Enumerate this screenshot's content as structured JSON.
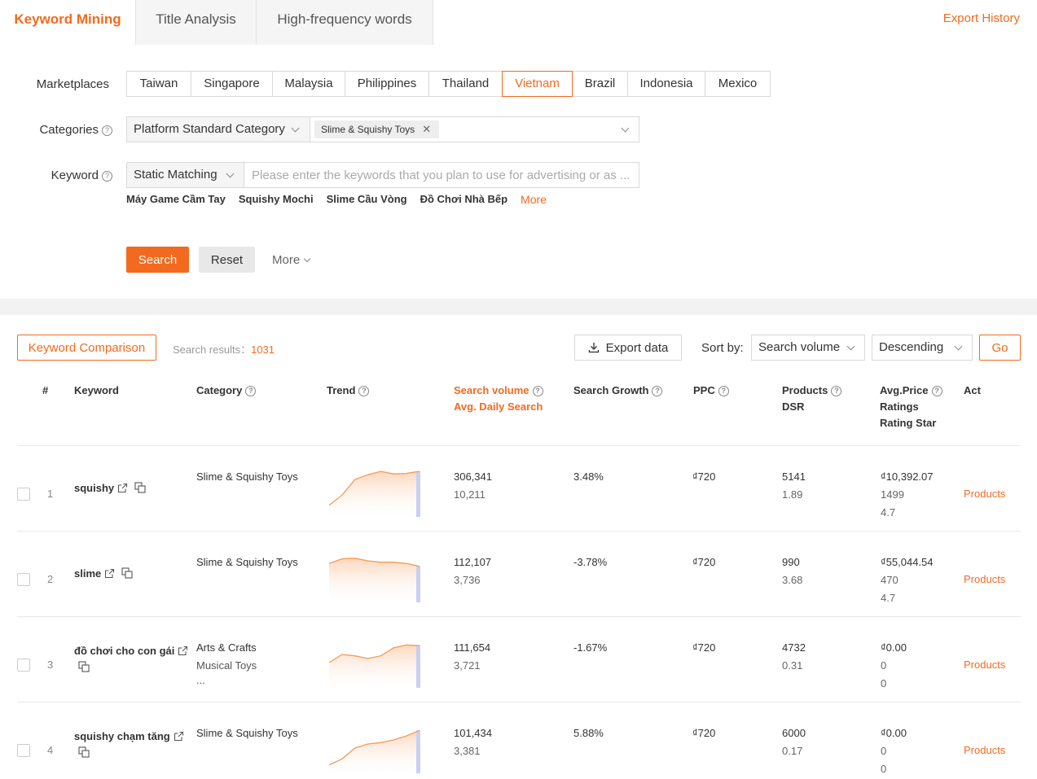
{
  "tabs": [
    "Keyword Mining",
    "Title Analysis",
    "High-frequency words"
  ],
  "export_history": "Export History",
  "filters": {
    "marketplaces_label": "Marketplaces",
    "marketplaces": [
      "Taiwan",
      "Singapore",
      "Malaysia",
      "Philippines",
      "Thailand",
      "Vietnam",
      "Brazil",
      "Indonesia",
      "Mexico"
    ],
    "selected_marketplace": "Vietnam",
    "categories_label": "Categories",
    "category_type": "Platform Standard Category",
    "category_tag": "Slime & Squishy Toys",
    "keyword_label": "Keyword",
    "match_type": "Static Matching",
    "keyword_placeholder": "Please enter the keywords that you plan to use for advertising or as ...",
    "suggestions": [
      "Máy Game Cầm Tay",
      "Squishy Mochi",
      "Slime Cầu Vòng",
      "Đồ Chơi Nhà Bếp"
    ],
    "suggest_more": "More",
    "search_btn": "Search",
    "reset_btn": "Reset",
    "more_toggle": "More"
  },
  "toolbar": {
    "compare_btn": "Keyword Comparison",
    "results_label": "Search results：",
    "results_count": "1031",
    "export_btn": "Export data",
    "sort_label": "Sort by:",
    "sort_field": "Search volume",
    "sort_order": "Descending",
    "go_btn": "Go"
  },
  "columns": {
    "index": "#",
    "keyword": "Keyword",
    "category": "Category",
    "trend": "Trend",
    "search_volume": "Search volume",
    "avg_daily": "Avg. Daily Search",
    "growth": "Search Growth",
    "ppc": "PPC",
    "products": "Products",
    "dsr": "DSR",
    "avg_price": "Avg.Price",
    "ratings": "Ratings",
    "rating_star": "Rating Star",
    "act": "Act"
  },
  "rows": [
    {
      "index": "1",
      "keyword": "squishy",
      "cat1": "Slime & Squishy Toys",
      "cat2": "",
      "cat3": "",
      "volume": "306,341",
      "daily": "10,211",
      "growth": "3.48%",
      "ppc": "₫720",
      "products": "5141",
      "dsr": "1.89",
      "price": "₫10,392.07",
      "ratings": "1499",
      "star": "4.7",
      "act": "Products",
      "trend": [
        10,
        25,
        48,
        55,
        60,
        56,
        57,
        60
      ]
    },
    {
      "index": "2",
      "keyword": "slime",
      "cat1": "Slime & Squishy Toys",
      "cat2": "",
      "cat3": "",
      "volume": "112,107",
      "daily": "3,736",
      "growth": "-3.78%",
      "ppc": "₫720",
      "products": "990",
      "dsr": "3.68",
      "price": "₫55,044.54",
      "ratings": "470",
      "star": "4.7",
      "act": "Products",
      "trend": [
        50,
        57,
        58,
        54,
        52,
        52,
        50,
        46
      ]
    },
    {
      "index": "3",
      "keyword": "đồ chơi cho con gái",
      "cat1": "Arts & Crafts",
      "cat2": "Musical Toys",
      "cat3": "...",
      "volume": "111,654",
      "daily": "3,721",
      "growth": "-1.67%",
      "ppc": "₫720",
      "products": "4732",
      "dsr": "0.31",
      "price": "₫0.00",
      "ratings": "0",
      "star": "0",
      "act": "Products",
      "trend": [
        30,
        42,
        40,
        36,
        40,
        52,
        56,
        55
      ]
    },
    {
      "index": "4",
      "keyword": "squishy chạm tăng",
      "cat1": "Slime & Squishy Toys",
      "cat2": "",
      "cat3": "",
      "volume": "101,434",
      "daily": "3,381",
      "growth": "5.88%",
      "ppc": "₫720",
      "products": "6000",
      "dsr": "0.17",
      "price": "₫0.00",
      "ratings": "0",
      "star": "0",
      "act": "Products",
      "trend": [
        5,
        14,
        30,
        36,
        38,
        42,
        48,
        56
      ]
    }
  ]
}
